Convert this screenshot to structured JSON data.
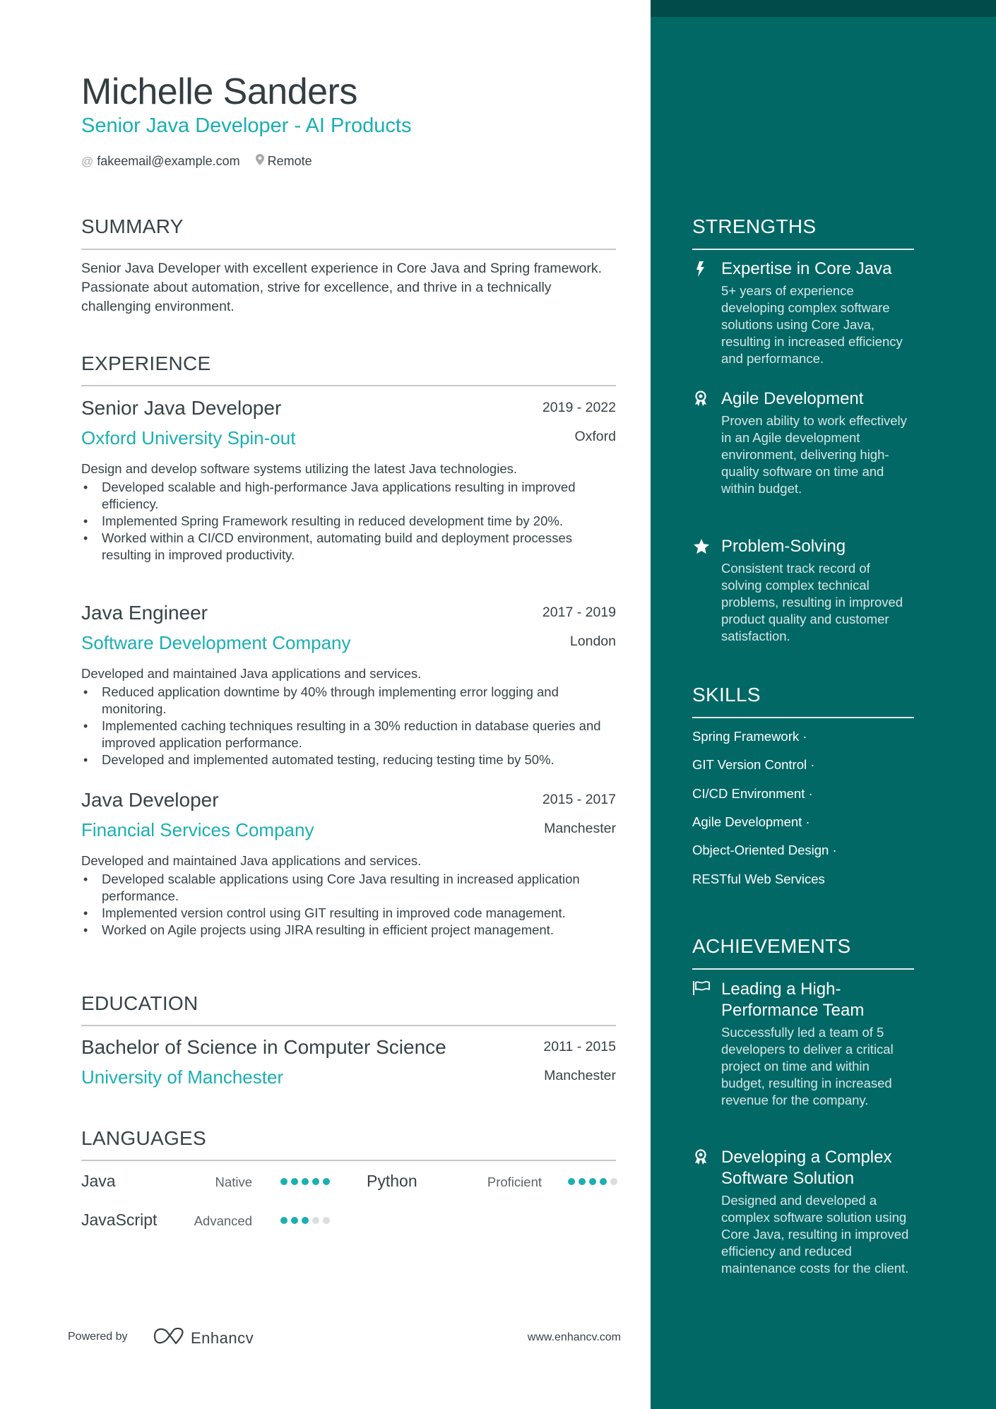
{
  "header": {
    "name": "Michelle Sanders",
    "title": "Senior Java Developer - AI Products",
    "email_icon": "at-icon",
    "email": "fakeemail@example.com",
    "location_icon": "map-pin-icon",
    "location": "Remote"
  },
  "summary": {
    "heading": "SUMMARY",
    "text": "Senior Java Developer with excellent experience in Core Java and Spring framework. Passionate about automation, strive for excellence, and thrive in a technically challenging environment."
  },
  "experience": {
    "heading": "EXPERIENCE",
    "jobs": [
      {
        "role": "Senior Java Developer",
        "dates": "2019 - 2022",
        "company": "Oxford University Spin-out",
        "location": "Oxford",
        "description": "Design and develop software systems utilizing the latest Java technologies.",
        "bullets": [
          "Developed scalable and high-performance Java applications resulting in improved efficiency.",
          "Implemented Spring Framework resulting in reduced development time by 20%.",
          "Worked within a CI/CD environment, automating build and deployment processes resulting in improved productivity."
        ]
      },
      {
        "role": "Java Engineer",
        "dates": "2017 - 2019",
        "company": "Software Development Company",
        "location": "London",
        "description": "Developed and maintained Java applications and services.",
        "bullets": [
          "Reduced application downtime by 40% through implementing error logging and monitoring.",
          "Implemented caching techniques resulting in a 30% reduction in database queries and improved application performance.",
          "Developed and implemented automated testing, reducing testing time by 50%."
        ]
      },
      {
        "role": "Java Developer",
        "dates": "2015 - 2017",
        "company": "Financial Services Company",
        "location": "Manchester",
        "description": "Developed and maintained Java applications and services.",
        "bullets": [
          "Developed scalable applications using Core Java resulting in increased application performance.",
          "Implemented version control using GIT resulting in improved code management.",
          "Worked on Agile projects using JIRA resulting in efficient project management."
        ]
      }
    ]
  },
  "education": {
    "heading": "EDUCATION",
    "items": [
      {
        "degree": "Bachelor of Science in Computer Science",
        "dates": "2011 - 2015",
        "school": "University of Manchester",
        "location": "Manchester"
      }
    ]
  },
  "languages": {
    "heading": "LANGUAGES",
    "items": [
      {
        "name": "Java",
        "level": "Native",
        "rating": 5,
        "max": 5
      },
      {
        "name": "Python",
        "level": "Proficient",
        "rating": 4,
        "max": 5
      },
      {
        "name": "JavaScript",
        "level": "Advanced",
        "rating": 3,
        "max": 5
      }
    ]
  },
  "strengths": {
    "heading": "STRENGTHS",
    "items": [
      {
        "icon": "lightning-bolt-icon",
        "title": "Expertise in Core Java",
        "description": "5+ years of experience developing complex software solutions using Core Java, resulting in increased efficiency and performance."
      },
      {
        "icon": "award-ribbon-icon",
        "title": "Agile Development",
        "description": "Proven ability to work effectively in an Agile development environment, delivering high-quality software on time and within budget."
      },
      {
        "icon": "star-icon",
        "title": "Problem-Solving",
        "description": "Consistent track record of solving complex technical problems, resulting in improved product quality and customer satisfaction."
      }
    ]
  },
  "skills": {
    "heading": "SKILLS",
    "items": [
      "Spring Framework ·",
      "GIT Version Control ·",
      "CI/CD Environment ·",
      "Agile Development ·",
      "Object-Oriented Design ·",
      "RESTful Web Services"
    ]
  },
  "achievements": {
    "heading": "ACHIEVEMENTS",
    "items": [
      {
        "icon": "flag-icon",
        "title": "Leading a High-Performance Team",
        "description": "Successfully led a team of 5 developers to deliver a critical project on time and within budget, resulting in increased revenue for the company."
      },
      {
        "icon": "award-ribbon-icon",
        "title": "Developing a Complex Software Solution",
        "description": "Designed and developed a complex software solution using Core Java, resulting in improved efficiency and reduced maintenance costs for the client."
      }
    ]
  },
  "footer": {
    "powered_by": "Powered by",
    "brand": "Enhancv",
    "website": "www.enhancv.com"
  },
  "colors": {
    "accent": "#1aafb2",
    "sidebar": "#016866",
    "sidebar_band": "#014b4a",
    "text": "#384347",
    "dot_empty": "#dddddd"
  }
}
